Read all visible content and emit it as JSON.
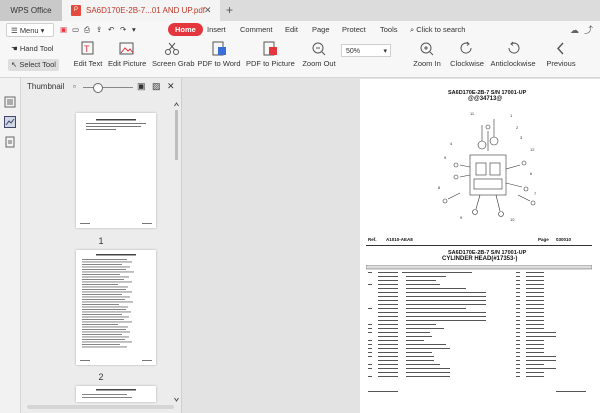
{
  "titlebar": {
    "app_tab": "WPS Office",
    "doc_tab": "SA6D170E-2B-7...01 AND UP.pdf",
    "new_tab": "+"
  },
  "menubar": {
    "menu_label": "Menu",
    "items": [
      {
        "label": "Home",
        "active": true
      },
      {
        "label": "Insert"
      },
      {
        "label": "Comment"
      },
      {
        "label": "Edit"
      },
      {
        "label": "Page"
      },
      {
        "label": "Protect"
      },
      {
        "label": "Tools"
      }
    ],
    "search_label": "Click to search"
  },
  "toolbar": {
    "hand_tool": "Hand Tool",
    "select_tool": "Select Tool",
    "edit_text": "Edit Text",
    "edit_picture": "Edit Picture",
    "screen_grab": "Screen Grab",
    "pdf_to_word": "PDF to Word",
    "pdf_to_picture": "PDF to Picture",
    "zoom_out": "Zoom Out",
    "zoom_value": "50%",
    "zoom_in": "Zoom In",
    "clockwise": "Clockwise",
    "anticlockwise": "Anticlockwise",
    "previous": "Previous"
  },
  "thumbnail_panel": {
    "title": "Thumbnail",
    "pages": [
      {
        "number": "1"
      },
      {
        "number": "2"
      }
    ]
  },
  "document": {
    "header_title": "SA6D170E-2B-7 S/N 17001-UP",
    "header_sub": "@@34713@",
    "ref_label": "Ref.",
    "ref_code": "A1010-AEA8",
    "page_label": "Page",
    "page_code": "030010",
    "section_title": "SA6D170E-2B-7 S/N 17001-UP",
    "section_sub": "CYLINDER HEAD(#17353-)",
    "colors": {
      "accent": "#e4363d",
      "pdf_icon": "#e14a3c"
    }
  }
}
